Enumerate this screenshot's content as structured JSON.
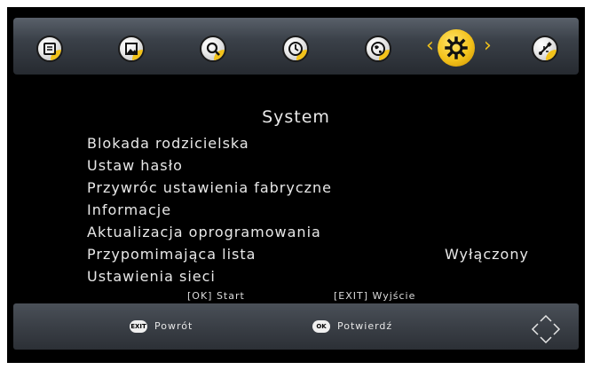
{
  "menu_icons": [
    "list-icon",
    "picture-icon",
    "search-icon",
    "clock-icon",
    "globe-icon",
    "settings-icon",
    "usb-icon"
  ],
  "active_index": 5,
  "colors": {
    "accent": "#f2c21a",
    "background": "#000000",
    "bar": "#3a3f46",
    "text": "#e8e8e8"
  },
  "page": {
    "title": "System"
  },
  "menu": {
    "items": [
      {
        "label": "Blokada rodzicielska"
      },
      {
        "label": "Ustaw hasło"
      },
      {
        "label": "Przywróc ustawienia fabryczne"
      },
      {
        "label": "Informacje"
      },
      {
        "label": "Aktualizacja oprogramowania"
      },
      {
        "label": "Przypomimająca lista",
        "value": "Wyłączony"
      },
      {
        "label": "Ustawienia sieci"
      }
    ]
  },
  "hints": {
    "ok": "[OK] Start",
    "exit": "[EXIT] Wyjście"
  },
  "bottom": {
    "exit_badge": "EXIT",
    "back_label": "Powrót",
    "ok_badge": "OK",
    "confirm_label": "Potwierdź"
  }
}
